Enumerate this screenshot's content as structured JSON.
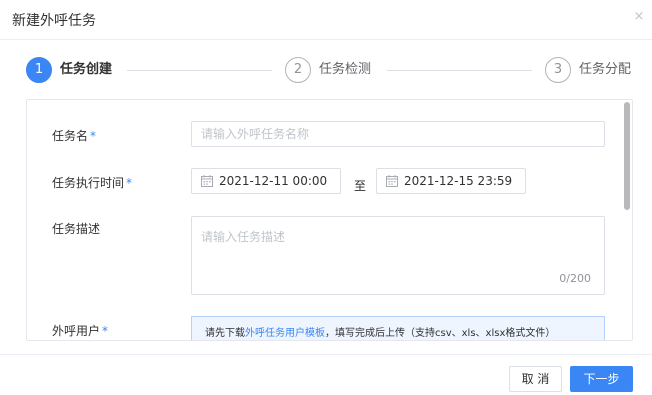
{
  "dialog": {
    "title": "新建外呼任务",
    "close_glyph": "×"
  },
  "steps": [
    {
      "number": "1",
      "label": "任务创建"
    },
    {
      "number": "2",
      "label": "任务检测"
    },
    {
      "number": "3",
      "label": "任务分配"
    }
  ],
  "form": {
    "task_name": {
      "label": "任务名",
      "required_mark": "*",
      "placeholder": "请输入外呼任务名称"
    },
    "exec_time": {
      "label": "任务执行时间",
      "required_mark": "*",
      "start": "2021-12-11 00:00",
      "separator": "至",
      "end": "2021-12-15 23:59"
    },
    "description": {
      "label": "任务描述",
      "placeholder": "请输入任务描述",
      "count": "0/200"
    },
    "users": {
      "label": "外呼用户",
      "required_mark": "*",
      "tip_prefix": "请先下载",
      "tip_link": "外呼任务用户模板",
      "tip_suffix": "，填写完成后上传（支持csv、xls、xlsx格式文件）"
    }
  },
  "footer": {
    "cancel": "取 消",
    "next": "下一步"
  },
  "colors": {
    "accent": "#3a86f5",
    "border": "#dcdfe6",
    "tip_background": "#eef5fe"
  }
}
